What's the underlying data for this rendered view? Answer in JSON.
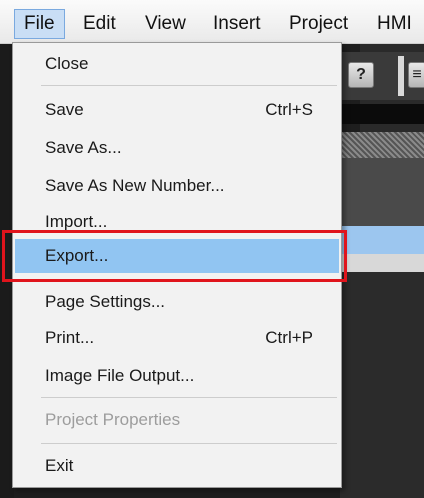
{
  "menubar": {
    "items": [
      "File",
      "Edit",
      "View",
      "Insert",
      "Project",
      "HMI"
    ],
    "active_index": 0
  },
  "toolbar": {
    "help_icon_glyph": "?",
    "partial_icon_glyph": "≡"
  },
  "file_menu": {
    "close": "Close",
    "save": "Save",
    "save_shortcut": "Ctrl+S",
    "save_as": "Save As...",
    "save_as_new_number": "Save As New Number...",
    "import": "Import...",
    "export": "Export...",
    "page_settings": "Page Settings...",
    "print": "Print...",
    "print_shortcut": "Ctrl+P",
    "image_file_output": "Image File Output...",
    "project_properties": "Project Properties",
    "exit": "Exit",
    "highlighted_item": "export"
  },
  "colors": {
    "highlight": "#91c5f2",
    "annotation_box": "#e0141c",
    "menu_background": "#f2f2f2"
  }
}
